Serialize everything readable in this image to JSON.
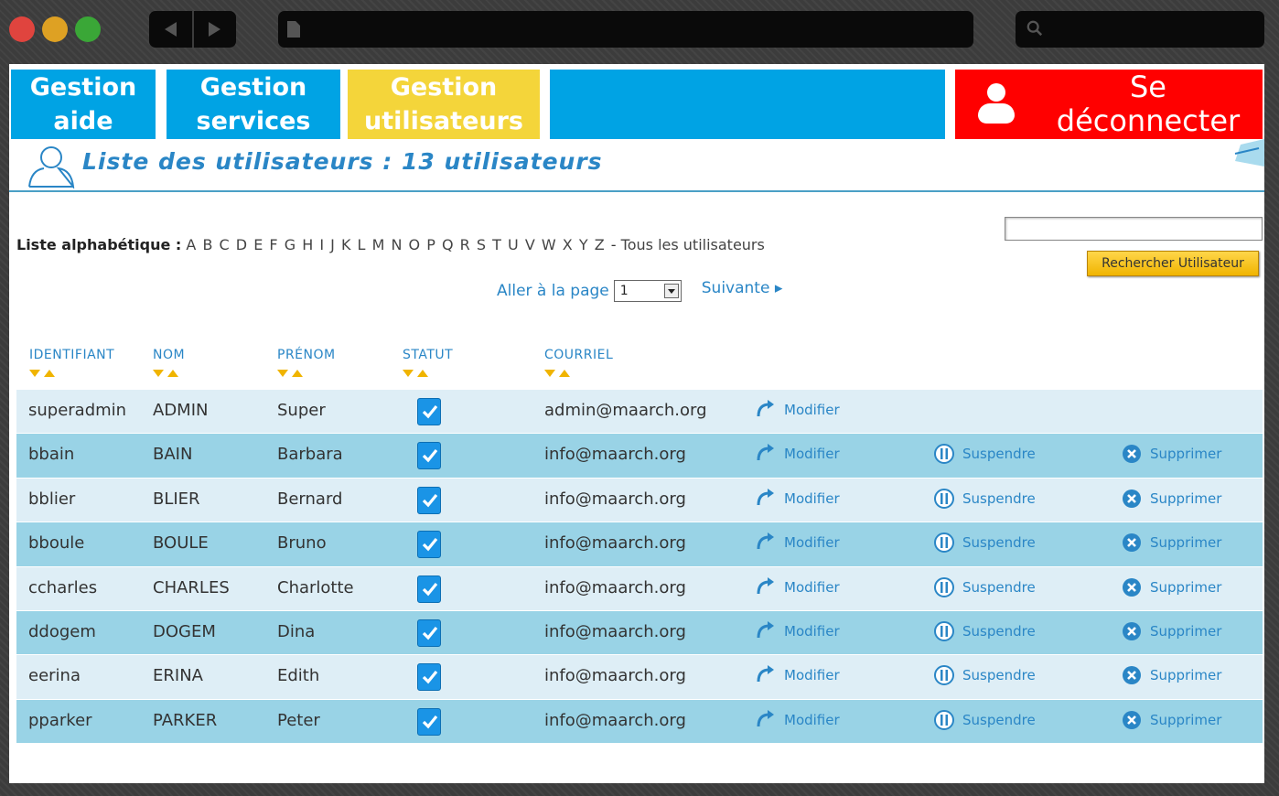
{
  "window": {
    "colors": {
      "close": "#e0443e",
      "minimize": "#dea123",
      "maximize": "#3aa737"
    }
  },
  "tabs": [
    {
      "label_line1": "Gestion",
      "label_line2": "aide"
    },
    {
      "label_line1": "Gestion",
      "label_line2": "services"
    },
    {
      "label_line1": "Gestion",
      "label_line2": "utilisateurs",
      "active": true
    },
    {
      "label_line1": "",
      "label_line2": ""
    }
  ],
  "logout": {
    "label": "Se déconnecter",
    "icon": "user-icon"
  },
  "header": {
    "title": "Liste des utilisateurs : 13 utilisateurs",
    "icon": "user-outline-icon"
  },
  "alphabet": {
    "label": "Liste alphabétique :",
    "letters": [
      "A",
      "B",
      "C",
      "D",
      "E",
      "F",
      "G",
      "H",
      "I",
      "J",
      "K",
      "L",
      "M",
      "N",
      "O",
      "P",
      "Q",
      "R",
      "S",
      "T",
      "U",
      "V",
      "W",
      "X",
      "Y",
      "Z"
    ],
    "separator": "-",
    "all_label": "Tous les utilisateurs"
  },
  "search": {
    "value": "",
    "button_label": "Rechercher Utilisateur"
  },
  "pager": {
    "goto_label": "Aller à la page",
    "selected_page": "1",
    "next_label": "Suivante"
  },
  "columns": {
    "id": "IDENTIFIANT",
    "nom": "NOM",
    "prenom": "PRÉNOM",
    "statut": "STATUT",
    "courriel": "COURRIEL"
  },
  "actions": {
    "modify": "Modifier",
    "suspend": "Suspendre",
    "delete": "Supprimer"
  },
  "users": [
    {
      "id": "superadmin",
      "nom": "ADMIN",
      "prenom": "Super",
      "active": true,
      "courriel": "admin@maarch.org",
      "can_suspend": false
    },
    {
      "id": "bbain",
      "nom": "BAIN",
      "prenom": "Barbara",
      "active": true,
      "courriel": "info@maarch.org",
      "can_suspend": true
    },
    {
      "id": "bblier",
      "nom": "BLIER",
      "prenom": "Bernard",
      "active": true,
      "courriel": "info@maarch.org",
      "can_suspend": true
    },
    {
      "id": "bboule",
      "nom": "BOULE",
      "prenom": "Bruno",
      "active": true,
      "courriel": "info@maarch.org",
      "can_suspend": true
    },
    {
      "id": "ccharles",
      "nom": "CHARLES",
      "prenom": "Charlotte",
      "active": true,
      "courriel": "info@maarch.org",
      "can_suspend": true
    },
    {
      "id": "ddogem",
      "nom": "DOGEM",
      "prenom": "Dina",
      "active": true,
      "courriel": "info@maarch.org",
      "can_suspend": true
    },
    {
      "id": "eerina",
      "nom": "ERINA",
      "prenom": "Edith",
      "active": true,
      "courriel": "info@maarch.org",
      "can_suspend": true
    },
    {
      "id": "pparker",
      "nom": "PARKER",
      "prenom": "Peter",
      "active": true,
      "courriel": "info@maarch.org",
      "can_suspend": true
    }
  ],
  "theme": {
    "tab_blue": "#00a3e4",
    "tab_yellow": "#f4d53a",
    "logout_red": "#ff0000",
    "link_blue": "#2a86c6",
    "row_light": "#deeef6",
    "row_dark": "#99d3e6"
  }
}
